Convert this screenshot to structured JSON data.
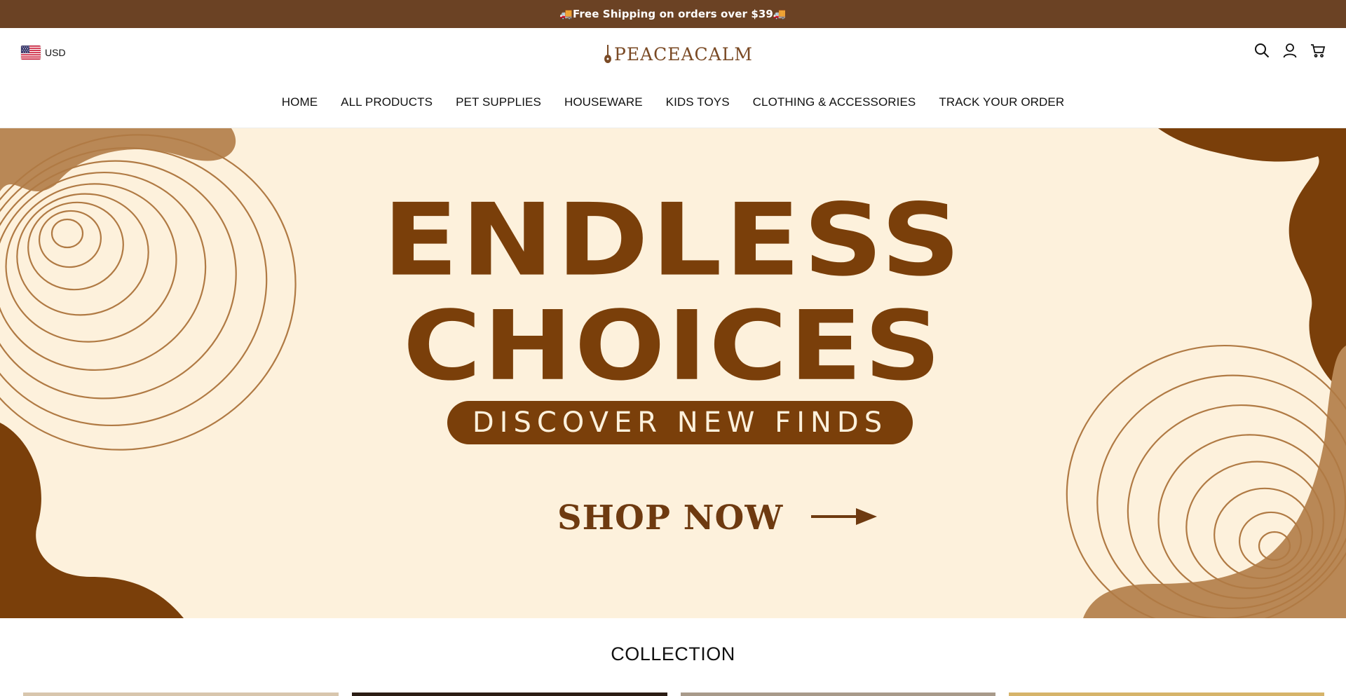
{
  "announcement": {
    "text": "🚚Free Shipping on orders over $39🚚"
  },
  "header": {
    "currency": {
      "code": "USD",
      "flag_icon": "us-flag-icon"
    },
    "logo": {
      "text": "PEACEACALM",
      "color": "#7a4a25"
    },
    "icons": {
      "search": "search-icon",
      "account": "account-icon",
      "cart": "cart-icon"
    }
  },
  "nav": {
    "items": [
      {
        "label": "HOME"
      },
      {
        "label": "ALL PRODUCTS"
      },
      {
        "label": "PET SUPPLIES"
      },
      {
        "label": "HOUSEWARE"
      },
      {
        "label": "KIDS TOYS"
      },
      {
        "label": "CLOTHING & ACCESSORIES"
      },
      {
        "label": "TRACK YOUR ORDER"
      }
    ]
  },
  "hero": {
    "line1": "ENDLESS",
    "line2": "CHOICES",
    "tagline": "DISCOVER NEW FINDS",
    "cta": "SHOP NOW",
    "colors": {
      "background": "#fdf1dc",
      "primary": "#7a3f0a",
      "accent": "#b88a5a"
    }
  },
  "collection": {
    "title": "COLLECTION",
    "cards": [
      {
        "name": "collection-card-1"
      },
      {
        "name": "collection-card-2"
      },
      {
        "name": "collection-card-3"
      },
      {
        "name": "collection-card-4"
      }
    ]
  },
  "colors": {
    "announcement_bg": "#6b4224",
    "text": "#111111"
  }
}
